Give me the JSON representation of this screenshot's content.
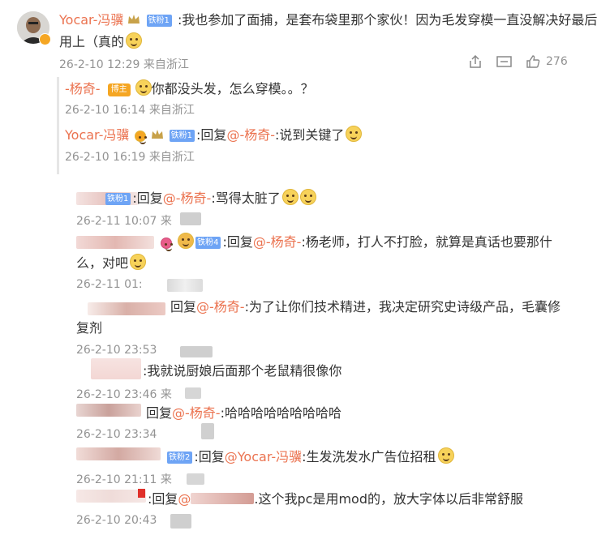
{
  "main": {
    "author": "Yocar-冯骥",
    "author_badge": "铁粉1",
    "text_line1": ":我也参加了面捕，是套布袋里那个家伙！因为毛发穿模一直没解决好最后没",
    "text_line2": "用上（真的",
    "time": "26-2-10 12:29 来自浙江",
    "like_count": "276"
  },
  "replies": [
    {
      "name": "-杨奇-",
      "badge": "博主",
      "text": "你都没头发，怎么穿模。。？",
      "time": "26-2-10 16:14 来自浙江"
    },
    {
      "name": "Yocar-冯骥",
      "badge": "铁粉1",
      "reply_prefix": ":回复",
      "at": "@-杨奇-",
      "text": ":说到关键了",
      "time": "26-2-10 16:19 来自浙江"
    }
  ],
  "sub_replies": [
    {
      "badge": "铁粉1",
      "reply_prefix": ":回复",
      "at": "@-杨奇-",
      "text": ":骂得太脏了",
      "time": "26-2-11 10:07"
    },
    {
      "badge": "铁粉4",
      "reply_prefix": ":回复",
      "at": "@-杨奇-",
      "text": ":杨老师，打人不打脸，就算是真话也要那什",
      "text2": "么，对吧",
      "time": "26-2-11 01:"
    },
    {
      "reply_prefix": "回复",
      "at": "@-杨奇-",
      "text": ":为了让你们技术精进，我决定研究史诗级产品，毛囊修",
      "text2": "复剂",
      "time": "26-2-10 23:53"
    },
    {
      "text": ":我就说厨娘后面那个老鼠精很像你",
      "time": "26-2-10 23:46 来"
    },
    {
      "reply_prefix": "回复",
      "at": "@-杨奇-",
      "text": ":哈哈哈哈哈哈哈哈哈",
      "time": "26-2-10 23:34"
    },
    {
      "badge": "铁粉2",
      "reply_prefix": ":回复",
      "at": "@Yocar-冯骥",
      "text": ":生发洗发水广告位招租",
      "time": "26-2-10 21:11 来"
    },
    {
      "reply_prefix": ":回复",
      "at": "@",
      "text": ".这个我pc是用mod的，放大字体以后非常舒服",
      "time": "26-2-10 20:43"
    }
  ]
}
